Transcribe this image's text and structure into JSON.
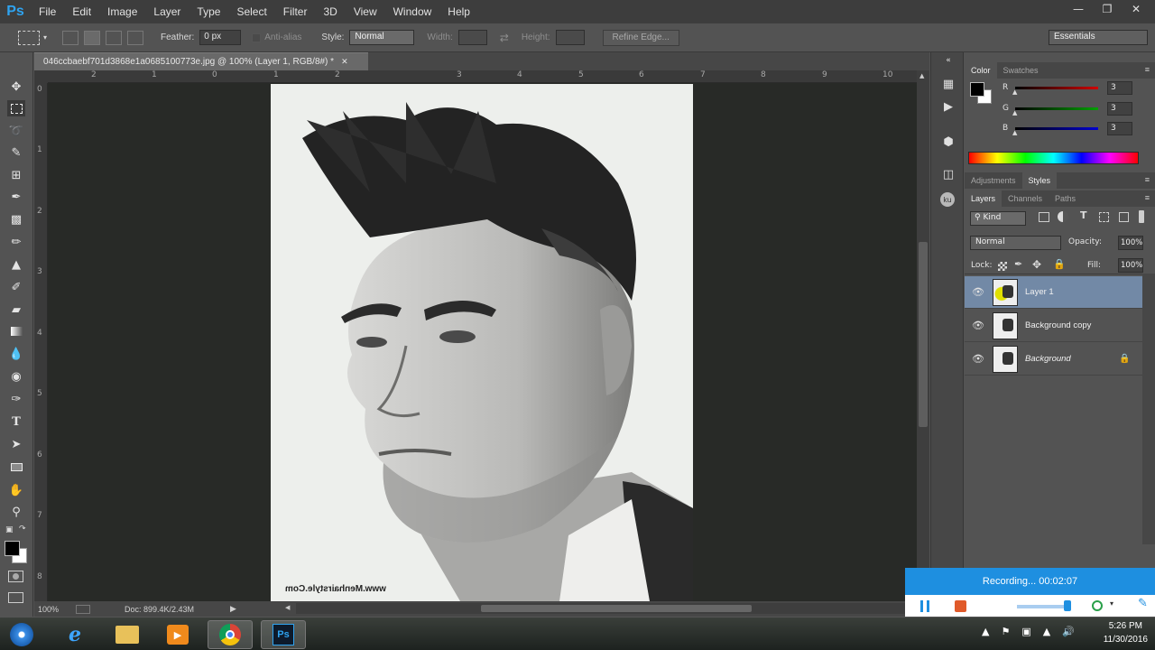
{
  "app": {
    "logo": "Ps"
  },
  "menu": [
    "File",
    "Edit",
    "Image",
    "Layer",
    "Type",
    "Select",
    "Filter",
    "3D",
    "View",
    "Window",
    "Help"
  ],
  "options": {
    "feather_label": "Feather:",
    "feather_value": "0 px",
    "anti_alias_label": "Anti-alias",
    "style_label": "Style:",
    "style_value": "Normal",
    "width_label": "Width:",
    "height_label": "Height:",
    "refine_edge": "Refine Edge...",
    "workspace": "Essentials"
  },
  "document": {
    "tab_title": "046ccbaebf701d3868e1a0685100773e.jpg @ 100% (Layer 1, RGB/8#) *",
    "ruler_h": [
      "2",
      "1",
      "0",
      "1",
      "2",
      "3",
      "4",
      "5",
      "6",
      "7",
      "8",
      "9",
      "10"
    ],
    "ruler_v": [
      "0",
      "1",
      "2",
      "3",
      "4",
      "5",
      "6",
      "7",
      "8"
    ],
    "watermark": "www.Menhairstyle.Com",
    "zoom": "100%",
    "doc_size": "Doc: 899.4K/2.43M"
  },
  "color_panel": {
    "tabs": [
      "Color",
      "Swatches"
    ],
    "channels": [
      {
        "label": "R",
        "value": "3",
        "color": "#d00000"
      },
      {
        "label": "G",
        "value": "3",
        "color": "#00a000"
      },
      {
        "label": "B",
        "value": "3",
        "color": "#0000d0"
      }
    ]
  },
  "adjust_panel": {
    "tabs": [
      "Adjustments",
      "Styles"
    ]
  },
  "layers_panel": {
    "tabs": [
      "Layers",
      "Channels",
      "Paths"
    ],
    "filter_kind": "Kind",
    "blend_mode": "Normal",
    "opacity_label": "Opacity:",
    "opacity_value": "100%",
    "lock_label": "Lock:",
    "fill_label": "Fill:",
    "fill_value": "100%",
    "layers": [
      {
        "name": "Layer 1",
        "selected": true
      },
      {
        "name": "Background copy",
        "selected": false
      },
      {
        "name": "Background",
        "selected": false,
        "locked": true
      }
    ]
  },
  "recording": {
    "text": "Recording... 00:02:07"
  },
  "taskbar": {
    "time": "5:26 PM",
    "date": "11/30/2016"
  }
}
